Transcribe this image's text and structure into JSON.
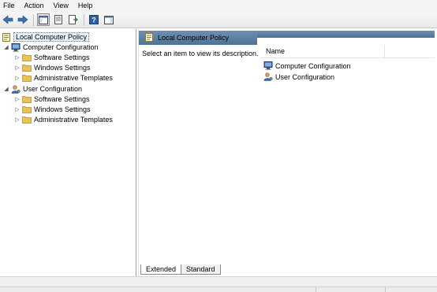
{
  "menubar": {
    "items": [
      {
        "label": "File"
      },
      {
        "label": "Action"
      },
      {
        "label": "View"
      },
      {
        "label": "Help"
      }
    ]
  },
  "toolbar": {
    "buttons": [
      {
        "icon": "back-arrow-icon"
      },
      {
        "icon": "forward-arrow-icon"
      },
      {
        "icon": "show-hide-console-tree-icon"
      },
      {
        "icon": "properties-icon"
      },
      {
        "icon": "export-list-icon"
      },
      {
        "icon": "help-icon"
      },
      {
        "icon": "show-hide-action-pane-icon"
      }
    ]
  },
  "tree": {
    "root": {
      "label": "Local Computer Policy",
      "icon": "policy-icon"
    },
    "nodes": [
      {
        "label": "Computer Configuration",
        "icon": "computer-icon",
        "children": [
          {
            "label": "Software Settings",
            "icon": "folder-icon"
          },
          {
            "label": "Windows Settings",
            "icon": "folder-icon"
          },
          {
            "label": "Administrative Templates",
            "icon": "folder-icon"
          }
        ]
      },
      {
        "label": "User Configuration",
        "icon": "user-icon",
        "children": [
          {
            "label": "Software Settings",
            "icon": "folder-icon"
          },
          {
            "label": "Windows Settings",
            "icon": "folder-icon"
          },
          {
            "label": "Administrative Templates",
            "icon": "folder-icon"
          }
        ]
      }
    ]
  },
  "details": {
    "header_title": "Local Computer Policy",
    "description": "Select an item to view its description.",
    "column_name": "Name",
    "items": [
      {
        "label": "Computer Configuration",
        "icon": "computer-icon"
      },
      {
        "label": "User Configuration",
        "icon": "user-icon"
      }
    ]
  },
  "tabs": [
    {
      "label": "Extended",
      "active": true
    },
    {
      "label": "Standard",
      "active": false
    }
  ],
  "colors": {
    "header_blue": "#4f7395",
    "folder_yellow": "#e8c35a"
  }
}
